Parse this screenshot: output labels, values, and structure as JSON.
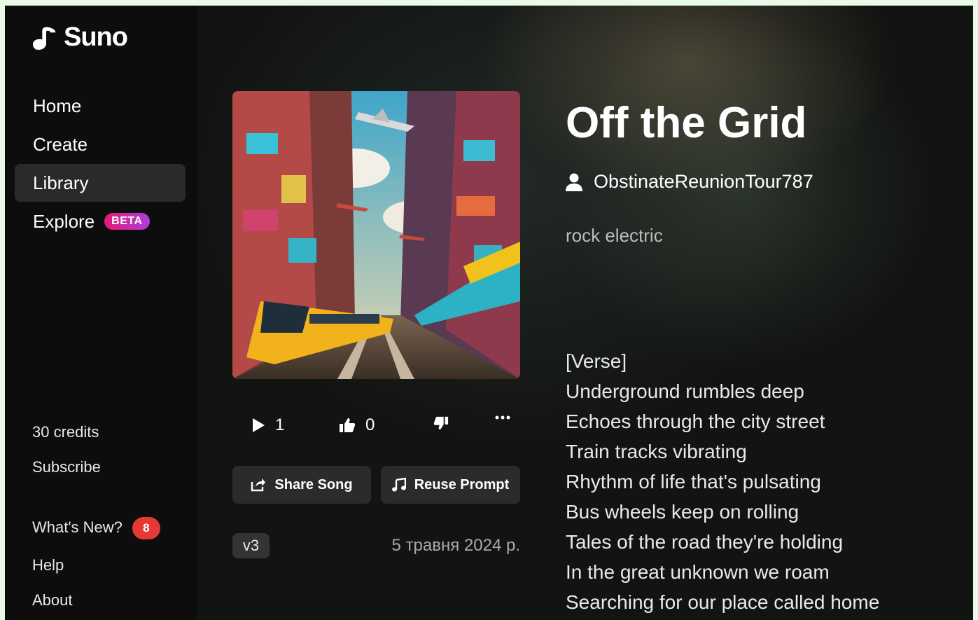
{
  "app": {
    "name": "Suno"
  },
  "sidebar": {
    "nav": [
      {
        "label": "Home"
      },
      {
        "label": "Create"
      },
      {
        "label": "Library"
      },
      {
        "label": "Explore",
        "badge": "BETA"
      }
    ],
    "credits": "30 credits",
    "subscribe": "Subscribe",
    "whats_new": {
      "label": "What's New?",
      "count": "8"
    },
    "help": "Help",
    "about": "About"
  },
  "song": {
    "title": "Off the Grid",
    "artist": "ObstinateReunionTour787",
    "style": "rock electric",
    "plays": "1",
    "likes": "0",
    "share_label": "Share Song",
    "reuse_label": "Reuse Prompt",
    "version": "v3",
    "date": "5 травня 2024 р.",
    "lyrics": [
      "[Verse]",
      "Underground rumbles deep",
      "Echoes through the city street",
      "Train tracks vibrating",
      "Rhythm of life that's pulsating",
      "Bus wheels keep on rolling",
      "Tales of the road they're holding",
      "In the great unknown we roam",
      "Searching for our place called home"
    ]
  },
  "colors": {
    "active_nav": "#2a2a2a",
    "badge_red": "#e53935",
    "beta_pink": "#e6197a"
  }
}
